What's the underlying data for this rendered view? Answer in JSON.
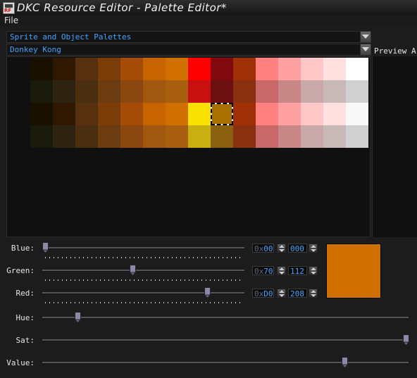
{
  "window": {
    "title": "DKC Resource Editor - Palette Editor*",
    "icon": "rf-app-icon"
  },
  "menu": {
    "items": [
      "File"
    ]
  },
  "dropdowns": {
    "palette_set": "Sprite and Object Palettes",
    "palette": "Donkey Kong"
  },
  "preview": {
    "label": "Preview A"
  },
  "palette": {
    "selected_index": 38,
    "colors": [
      "#1a1000",
      "#301800",
      "#573010",
      "#7a3d08",
      "#a54d08",
      "#c86400",
      "#d07000",
      "#ff0000",
      "#820810",
      "#a03008",
      "#ff8080",
      "#ffa0a0",
      "#ffc8c8",
      "#ffe0e0",
      "#ffffff",
      "#1a1a0a",
      "#2e2210",
      "#4a2e10",
      "#6a3c10",
      "#8a4810",
      "#a05810",
      "#a86010",
      "#c81010",
      "#6a1010",
      "#883010",
      "#c86868",
      "#c88888",
      "#c8a8a8",
      "#c8b8b8",
      "#d0d0d0",
      "#1a1000",
      "#301800",
      "#573010",
      "#7a3d08",
      "#a54d08",
      "#c86400",
      "#d07000",
      "#f8e000",
      "#a87000",
      "#a03008",
      "#ff8080",
      "#ffa0a0",
      "#ffc8c8",
      "#ffe0e0",
      "#f8f8f8",
      "#1a1a0a",
      "#2e2210",
      "#4a2e10",
      "#6a3c10",
      "#8a4810",
      "#a05810",
      "#a86010",
      "#c8b010",
      "#886010",
      "#883010",
      "#c86868",
      "#c88888",
      "#c8a8a8",
      "#c8b8b8",
      "#d0d0d0"
    ]
  },
  "sliders": {
    "blue": {
      "label": "Blue:",
      "hex": "00",
      "dec": "000",
      "level": 0
    },
    "green": {
      "label": "Green:",
      "hex": "70",
      "dec": "112",
      "level": 112
    },
    "red": {
      "label": "Red:",
      "hex": "D0",
      "dec": "208",
      "level": 208
    },
    "hue": {
      "label": "Hue:",
      "level": 0.09
    },
    "sat": {
      "label": "Sat:",
      "level": 1.0
    },
    "value": {
      "label": "Value:",
      "level": 0.83
    },
    "hex_prefix": "0x"
  },
  "current_color": "#d07000"
}
